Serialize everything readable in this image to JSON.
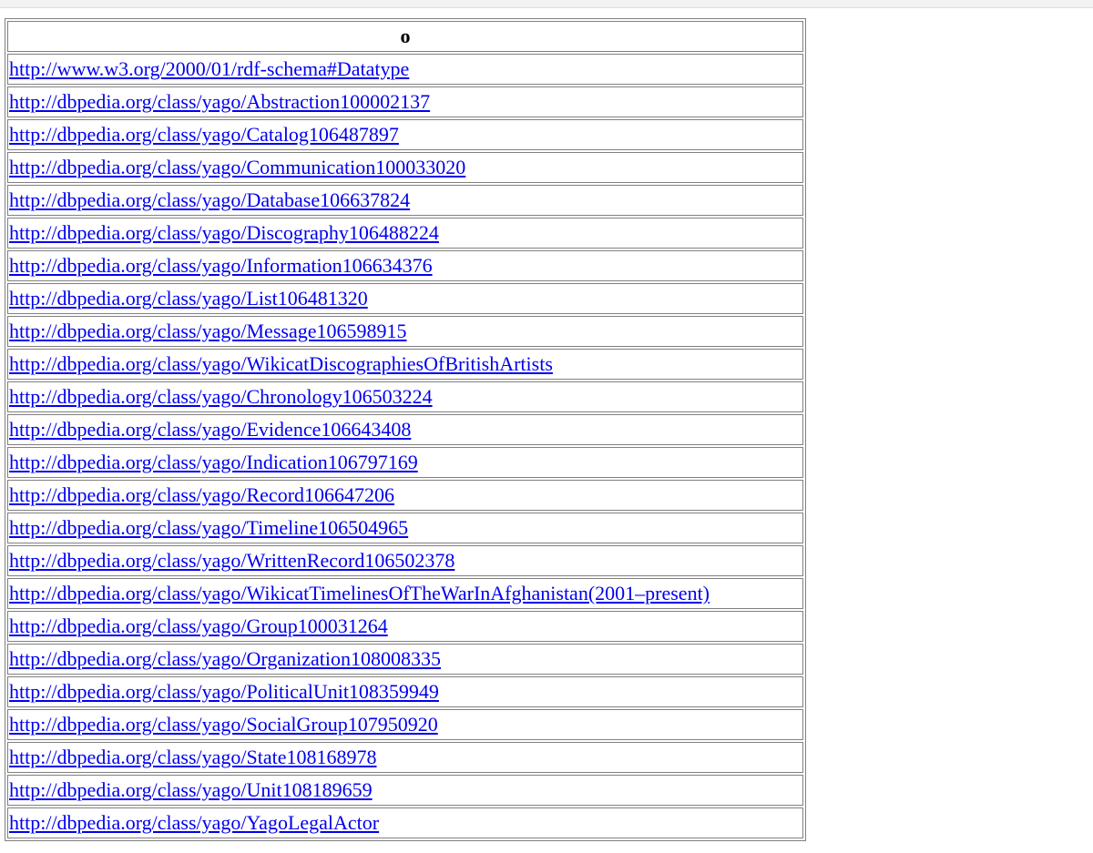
{
  "table": {
    "header": "o",
    "rows": [
      "http://www.w3.org/2000/01/rdf-schema#Datatype",
      "http://dbpedia.org/class/yago/Abstraction100002137",
      "http://dbpedia.org/class/yago/Catalog106487897",
      "http://dbpedia.org/class/yago/Communication100033020",
      "http://dbpedia.org/class/yago/Database106637824",
      "http://dbpedia.org/class/yago/Discography106488224",
      "http://dbpedia.org/class/yago/Information106634376",
      "http://dbpedia.org/class/yago/List106481320",
      "http://dbpedia.org/class/yago/Message106598915",
      "http://dbpedia.org/class/yago/WikicatDiscographiesOfBritishArtists",
      "http://dbpedia.org/class/yago/Chronology106503224",
      "http://dbpedia.org/class/yago/Evidence106643408",
      "http://dbpedia.org/class/yago/Indication106797169",
      "http://dbpedia.org/class/yago/Record106647206",
      "http://dbpedia.org/class/yago/Timeline106504965",
      "http://dbpedia.org/class/yago/WrittenRecord106502378",
      "http://dbpedia.org/class/yago/WikicatTimelinesOfTheWarInAfghanistan(2001–present)",
      "http://dbpedia.org/class/yago/Group100031264",
      "http://dbpedia.org/class/yago/Organization108008335",
      "http://dbpedia.org/class/yago/PoliticalUnit108359949",
      "http://dbpedia.org/class/yago/SocialGroup107950920",
      "http://dbpedia.org/class/yago/State108168978",
      "http://dbpedia.org/class/yago/Unit108189659",
      "http://dbpedia.org/class/yago/YagoLegalActor"
    ]
  }
}
